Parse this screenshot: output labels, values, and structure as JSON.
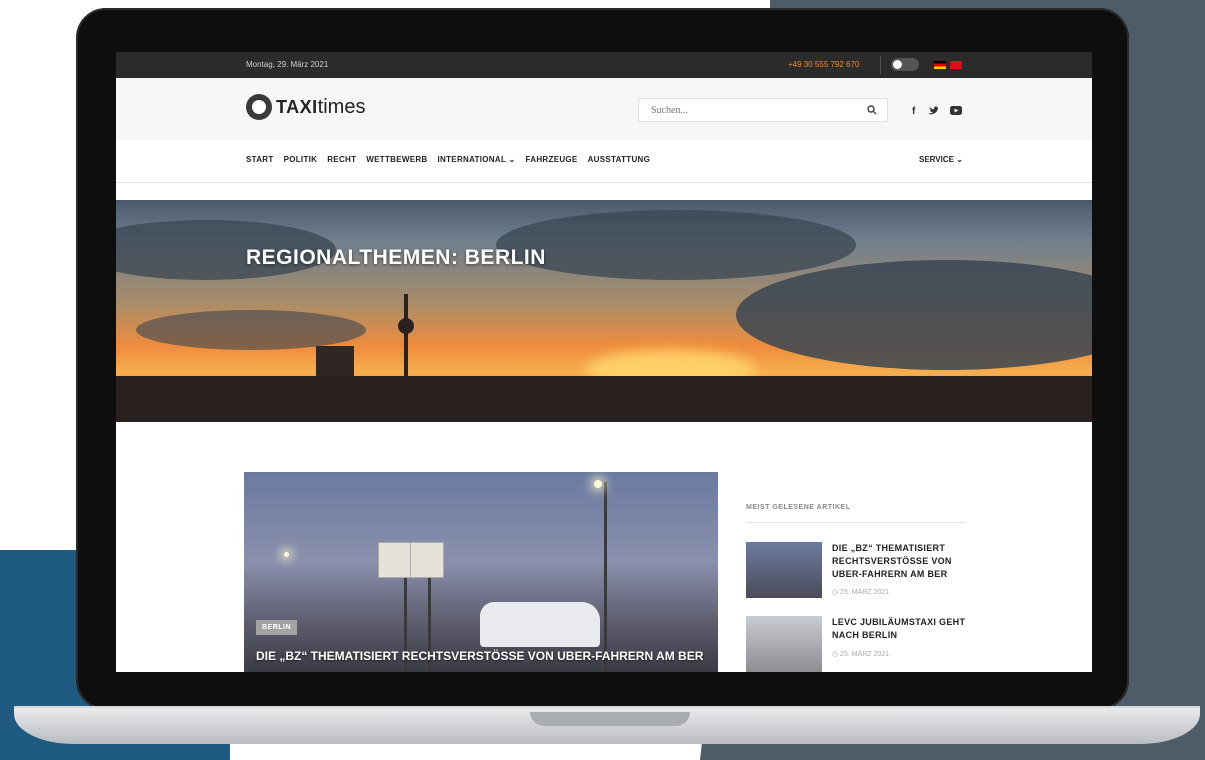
{
  "topbar": {
    "date": "Montag, 29. März 2021",
    "phone": "+49 30 555 792 670"
  },
  "header": {
    "logo_bold": "TAXI",
    "logo_light": "times",
    "search_placeholder": "Suchen...",
    "search_icon": "search-icon",
    "social": {
      "facebook": "f",
      "twitter": "🐦",
      "youtube": "▶"
    }
  },
  "nav": {
    "items": [
      "START",
      "POLITIK",
      "RECHT",
      "WETTBEWERB",
      "INTERNATIONAL ⌄",
      "FAHRZEUGE",
      "AUSSTATTUNG"
    ],
    "service": "SERVICE ⌄"
  },
  "hero": {
    "title": "REGIONALTHEMEN: BERLIN"
  },
  "article": {
    "badge": "BERLIN",
    "title": "DIE „BZ“ THEMATISIERT RECHTSVERSTÖSSE VON UBER-FAHRERN AM BER"
  },
  "sidebar": {
    "heading": "MEIST GELESENE ARTIKEL",
    "items": [
      {
        "title": "DIE „BZ“ THEMATISIERT RECHTSVERSTÖSSE VON UBER-FAHRERN AM BER",
        "date": "◷ 25. MÄRZ 2021"
      },
      {
        "title": "LEVC JUBILÄUMSTAXI GEHT NACH BERLIN",
        "date": "◷ 25. MÄRZ 2021"
      }
    ]
  },
  "colors": {
    "accent": "#f08a24",
    "topbar": "#2b2b2b",
    "slate": "#4e5b68",
    "blue": "#1f5a82"
  }
}
